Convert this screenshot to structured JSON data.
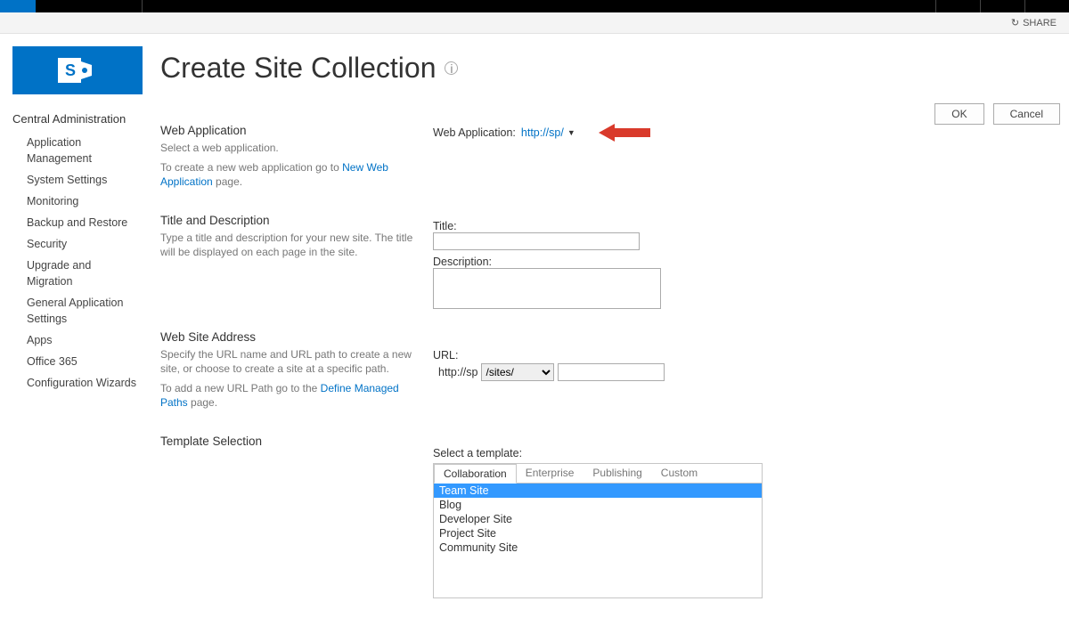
{
  "ribbon": {
    "share_label": "SHARE"
  },
  "sidebar": {
    "root_label": "Central Administration",
    "items": [
      "Application Management",
      "System Settings",
      "Monitoring",
      "Backup and Restore",
      "Security",
      "Upgrade and Migration",
      "General Application Settings",
      "Apps",
      "Office 365",
      "Configuration Wizards"
    ]
  },
  "page_title": "Create Site Collection",
  "buttons": {
    "ok": "OK",
    "cancel": "Cancel"
  },
  "sections": {
    "webapp": {
      "heading": "Web Application",
      "desc1": "Select a web application.",
      "desc2a": "To create a new web application go to ",
      "link": "New Web Application",
      "desc2b": " page."
    },
    "titledesc": {
      "heading": "Title and Description",
      "desc": "Type a title and description for your new site. The title will be displayed on each page in the site."
    },
    "address": {
      "heading": "Web Site Address",
      "desc1": "Specify the URL name and URL path to create a new site, or choose to create a site at a specific path.",
      "desc2a": "To add a new URL Path go to the ",
      "link": "Define Managed Paths",
      "desc2b": " page."
    },
    "template": {
      "heading": "Template Selection"
    }
  },
  "fields": {
    "webapp_label": "Web Application:",
    "webapp_value": "http://sp/",
    "title_label": "Title:",
    "title_value": "",
    "description_label": "Description:",
    "description_value": "",
    "url_label": "URL:",
    "url_prefix": "http://sp",
    "url_path_options": [
      "/sites/"
    ],
    "url_path_selected": "/sites/",
    "url_value": "",
    "template_label": "Select a template:",
    "tabs": [
      "Collaboration",
      "Enterprise",
      "Publishing",
      "Custom"
    ],
    "active_tab": "Collaboration",
    "templates": [
      "Team Site",
      "Blog",
      "Developer Site",
      "Project Site",
      "Community Site"
    ],
    "selected_template": "Team Site"
  }
}
